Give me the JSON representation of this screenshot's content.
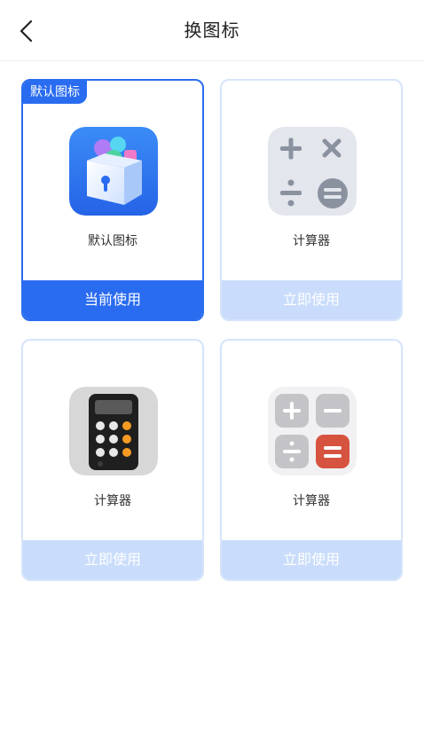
{
  "header": {
    "title": "换图标"
  },
  "cards": [
    {
      "label": "默认图标",
      "badge": "默认图标",
      "button": "当前使用",
      "active": true,
      "icon": "lock-box-icon"
    },
    {
      "label": "计算器",
      "button": "立即使用",
      "active": false,
      "icon": "calculator-light-icon"
    },
    {
      "label": "计算器",
      "button": "立即使用",
      "active": false,
      "icon": "calculator-dark-icon"
    },
    {
      "label": "计算器",
      "button": "立即使用",
      "active": false,
      "icon": "calculator-tiles-icon"
    }
  ],
  "colors": {
    "accent": "#2a6cf0",
    "inactive_button": "#c9dcfb",
    "card_border": "#d6e4fb"
  }
}
